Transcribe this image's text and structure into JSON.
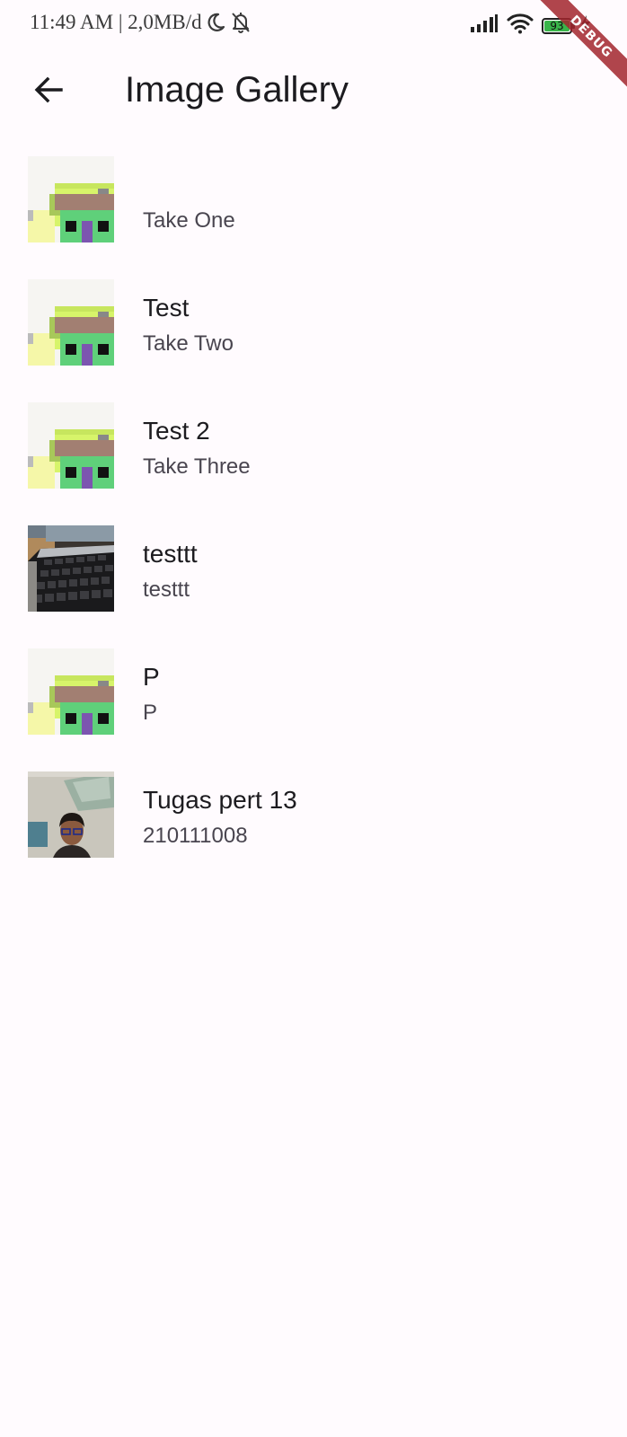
{
  "status_bar": {
    "time_info": "11:49 AM | 2,0MB/d",
    "battery_level": "93",
    "battery_color": "#39b54a",
    "icons": [
      "moon-icon",
      "bell-off-icon",
      "signal-icon",
      "wifi-icon",
      "battery-icon",
      "charging-icon"
    ]
  },
  "debug_banner": "DEBUG",
  "app_bar": {
    "title": "Image Gallery",
    "back_icon": "arrow-back-icon"
  },
  "gallery": {
    "items": [
      {
        "title": "",
        "subtitle": "Take One",
        "thumbnail": "pixel-house"
      },
      {
        "title": "Test",
        "subtitle": "Take Two",
        "thumbnail": "pixel-house"
      },
      {
        "title": "Test 2",
        "subtitle": "Take Three",
        "thumbnail": "pixel-house"
      },
      {
        "title": "testtt",
        "subtitle": "testtt",
        "thumbnail": "laptop-keyboard-photo"
      },
      {
        "title": "P",
        "subtitle": "P",
        "thumbnail": "pixel-house"
      },
      {
        "title": "Tugas pert 13",
        "subtitle": "210111008",
        "thumbnail": "selfie-photo"
      }
    ]
  }
}
